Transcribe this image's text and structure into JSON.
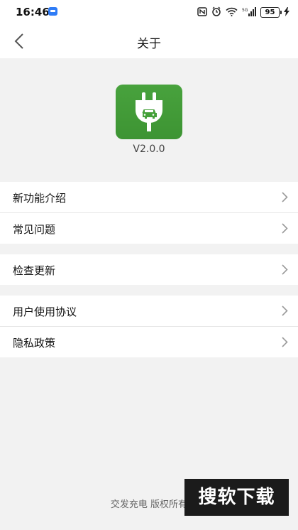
{
  "status_bar": {
    "time": "16:46",
    "battery": "95",
    "icons": [
      "notification-app-icon",
      "nfc-icon",
      "alarm-icon",
      "wifi-icon",
      "signal-5g-icon",
      "battery-icon",
      "charging-icon"
    ]
  },
  "nav": {
    "title": "关于",
    "back_icon": "chevron-left-icon"
  },
  "app": {
    "version": "V2.0.0",
    "icon": "plug-car-icon",
    "icon_color": "#44a039"
  },
  "groups": [
    {
      "items": [
        {
          "label": "新功能介绍"
        },
        {
          "label": "常见问题"
        }
      ]
    },
    {
      "items": [
        {
          "label": "检查更新"
        }
      ]
    },
    {
      "items": [
        {
          "label": "用户使用协议"
        },
        {
          "label": "隐私政策"
        }
      ]
    }
  ],
  "footer": {
    "text": "交发充电 版权所有"
  },
  "watermark": {
    "text": "搜软下载"
  },
  "colors": {
    "background": "#f2f2f2",
    "surface": "#ffffff",
    "accent": "#44a039"
  }
}
